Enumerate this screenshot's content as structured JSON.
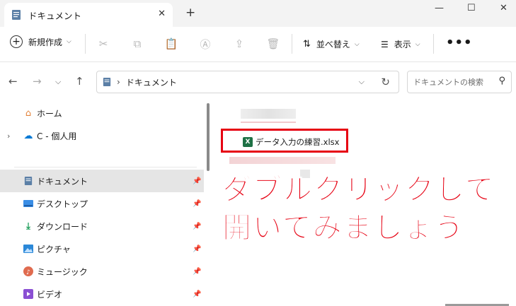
{
  "tab": {
    "title": "ドキュメント",
    "close": "✕",
    "new_tab": "+"
  },
  "window": {
    "minimize": "—",
    "maximize": "☐",
    "close": "✕"
  },
  "toolbar": {
    "new_label": "新規作成",
    "sort_label": "並べ替え",
    "view_label": "表示",
    "more_label": "•••"
  },
  "address": {
    "path_label": "ドキュメント",
    "search_placeholder": "ドキュメントの検索"
  },
  "sidebar": {
    "items": [
      {
        "label": "ホーム",
        "icon": "home-icon"
      },
      {
        "label": "C - 個人用",
        "icon": "cloud-icon"
      },
      {
        "label": "ドキュメント",
        "icon": "document-icon"
      },
      {
        "label": "デスクトップ",
        "icon": "desktop-icon"
      },
      {
        "label": "ダウンロード",
        "icon": "download-icon"
      },
      {
        "label": "ピクチャ",
        "icon": "pictures-icon"
      },
      {
        "label": "ミュージック",
        "icon": "music-icon"
      },
      {
        "label": "ビデオ",
        "icon": "video-icon"
      }
    ]
  },
  "main": {
    "file_name": "データ入力の練習.xlsx",
    "excel_badge": "X",
    "caption_line1": "ダブルクリックして",
    "caption_line2": "開いてみましょう"
  },
  "colors": {
    "accent_red": "#e60012",
    "excel_green": "#1e7145",
    "folder_blue": "#0078d4"
  }
}
